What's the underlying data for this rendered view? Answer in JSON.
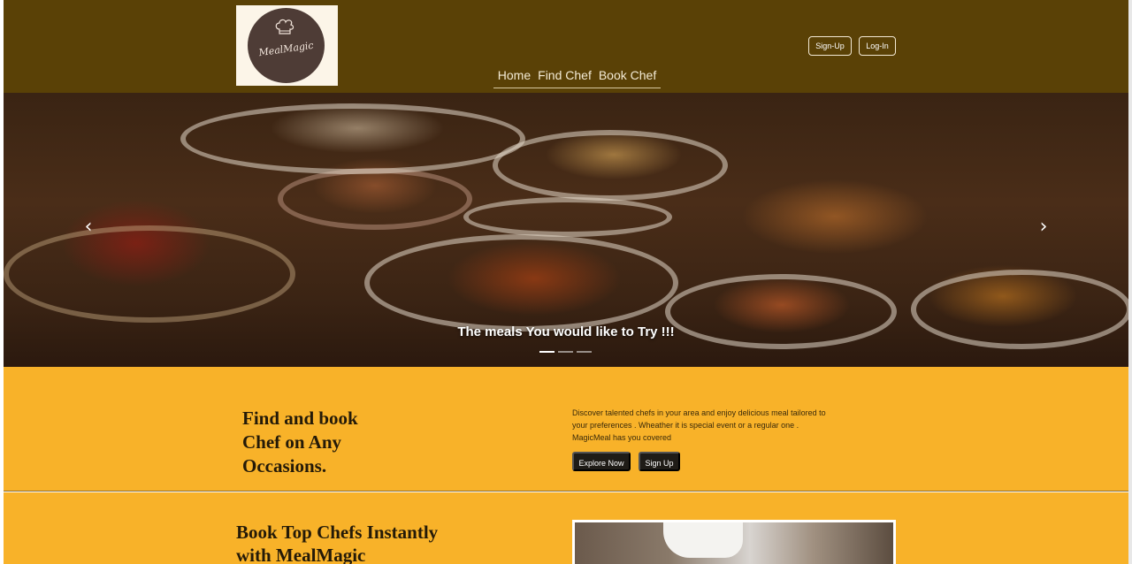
{
  "brand": {
    "logo_text": "MealMagic"
  },
  "header": {
    "signup_label": "Sign-Up",
    "login_label": "Log-In",
    "nav": [
      "Home",
      "Find Chef",
      "Book Chef"
    ]
  },
  "hero": {
    "caption": "The meals You would like to Try !!!",
    "prev_icon": "chevron-left-icon",
    "next_icon": "chevron-right-icon",
    "slides": 3,
    "active_slide": 1
  },
  "intro": {
    "title_lines": [
      "Find and book",
      "Chef on Any",
      "Occasions."
    ],
    "description": "Discover talented chefs in your area and enjoy delicious meal tailored to your preferences . Wheather it is special event or a regular one . MagicMeal has you covered",
    "explore_label": "Explore Now",
    "signup_label": "Sign Up"
  },
  "book": {
    "title_lines": [
      "Book Top Chefs Instantly",
      "with MealMagic"
    ]
  },
  "colors": {
    "header_bg": "#5a4106",
    "section_bg": "#f8b229",
    "button_dark": "#1f1c17",
    "logo_circle": "#4e3c36"
  }
}
